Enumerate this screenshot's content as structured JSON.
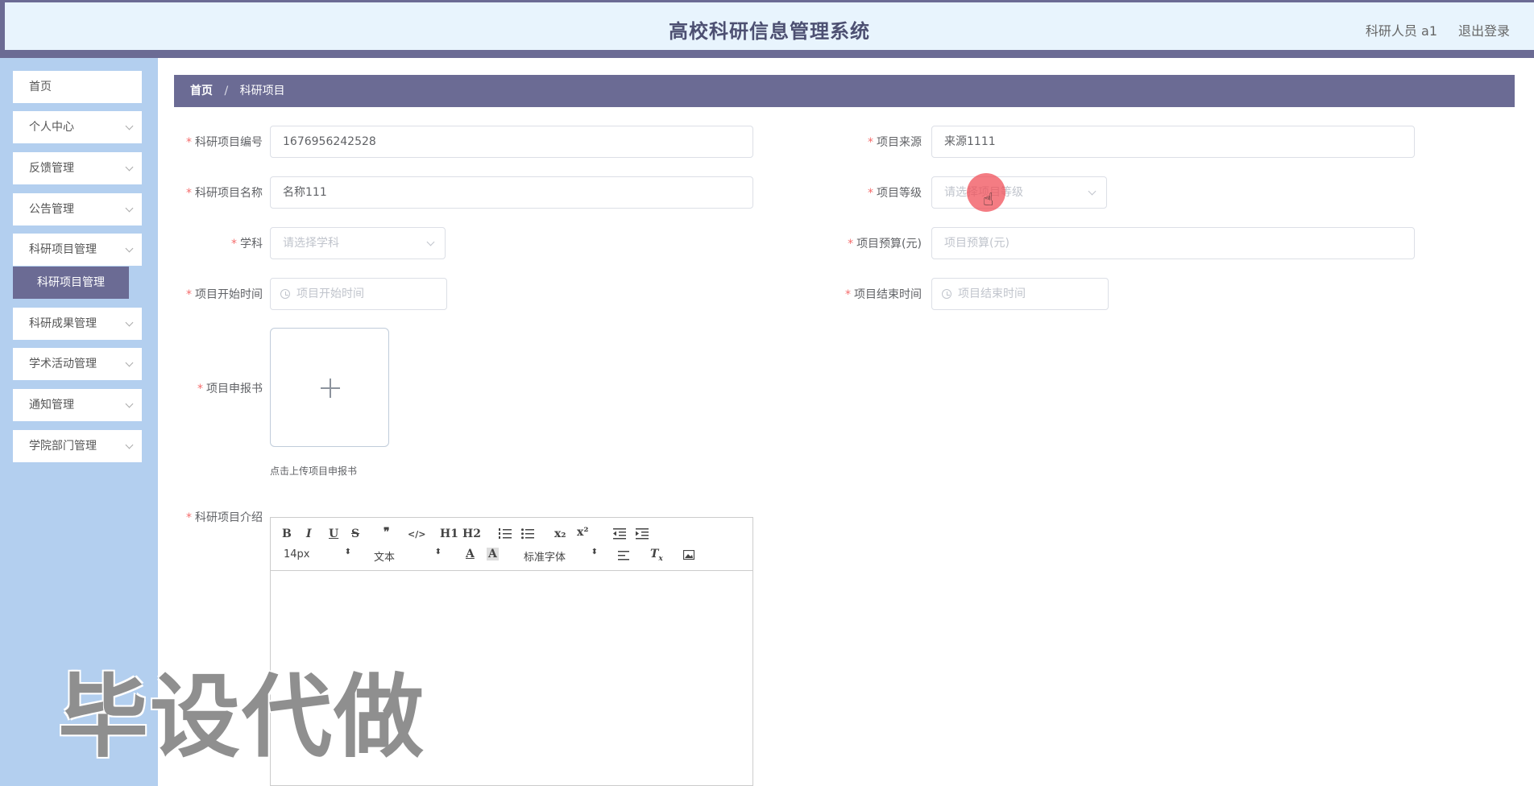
{
  "header": {
    "title": "高校科研信息管理系统",
    "user": "科研人员 a1",
    "logout": "退出登录"
  },
  "sidebar": {
    "items": [
      {
        "label": "首页",
        "has_chevron": false
      },
      {
        "label": "个人中心",
        "has_chevron": true
      },
      {
        "label": "反馈管理",
        "has_chevron": true
      },
      {
        "label": "公告管理",
        "has_chevron": true
      },
      {
        "label": "科研项目管理",
        "has_chevron": true
      },
      {
        "label": "科研成果管理",
        "has_chevron": true
      },
      {
        "label": "学术活动管理",
        "has_chevron": true
      },
      {
        "label": "通知管理",
        "has_chevron": true
      },
      {
        "label": "学院部门管理",
        "has_chevron": true
      }
    ],
    "active_submenu": "科研项目管理"
  },
  "breadcrumb": {
    "home": "首页",
    "separator": "/",
    "current": "科研项目"
  },
  "form": {
    "project_no": {
      "label": "科研项目编号",
      "value": "1676956242528"
    },
    "project_source": {
      "label": "项目来源",
      "value": "来源1111"
    },
    "project_name": {
      "label": "科研项目名称",
      "value": "名称111"
    },
    "project_level": {
      "label": "项目等级",
      "placeholder": "请选择项目等级"
    },
    "subject": {
      "label": "学科",
      "placeholder": "请选择学科"
    },
    "budget": {
      "label": "项目预算(元)",
      "placeholder": "项目预算(元)"
    },
    "start_time": {
      "label": "项目开始时间",
      "placeholder": "项目开始时间"
    },
    "end_time": {
      "label": "项目结束时间",
      "placeholder": "项目结束时间"
    },
    "report": {
      "label": "项目申报书",
      "tip": "点击上传项目申报书"
    },
    "intro": {
      "label": "科研项目介绍"
    }
  },
  "editor": {
    "font_size": "14px",
    "text_style": "文本",
    "font_family": "标准字体",
    "row1_buttons": [
      "B",
      "I",
      "U",
      "S",
      "❞",
      "</>",
      "H1",
      "H2",
      "ol",
      "ul",
      "x₂",
      "x²",
      "outdent",
      "indent"
    ],
    "row2_buttons": [
      "A",
      "A-bg",
      "align",
      "Tx",
      "image"
    ]
  },
  "watermark": "毕设代做",
  "colors": {
    "header_bg": "#e8f4fd",
    "accent": "#6b6b94",
    "sidebar_bg": "#b3cfef",
    "required_star": "#f56c6c"
  }
}
